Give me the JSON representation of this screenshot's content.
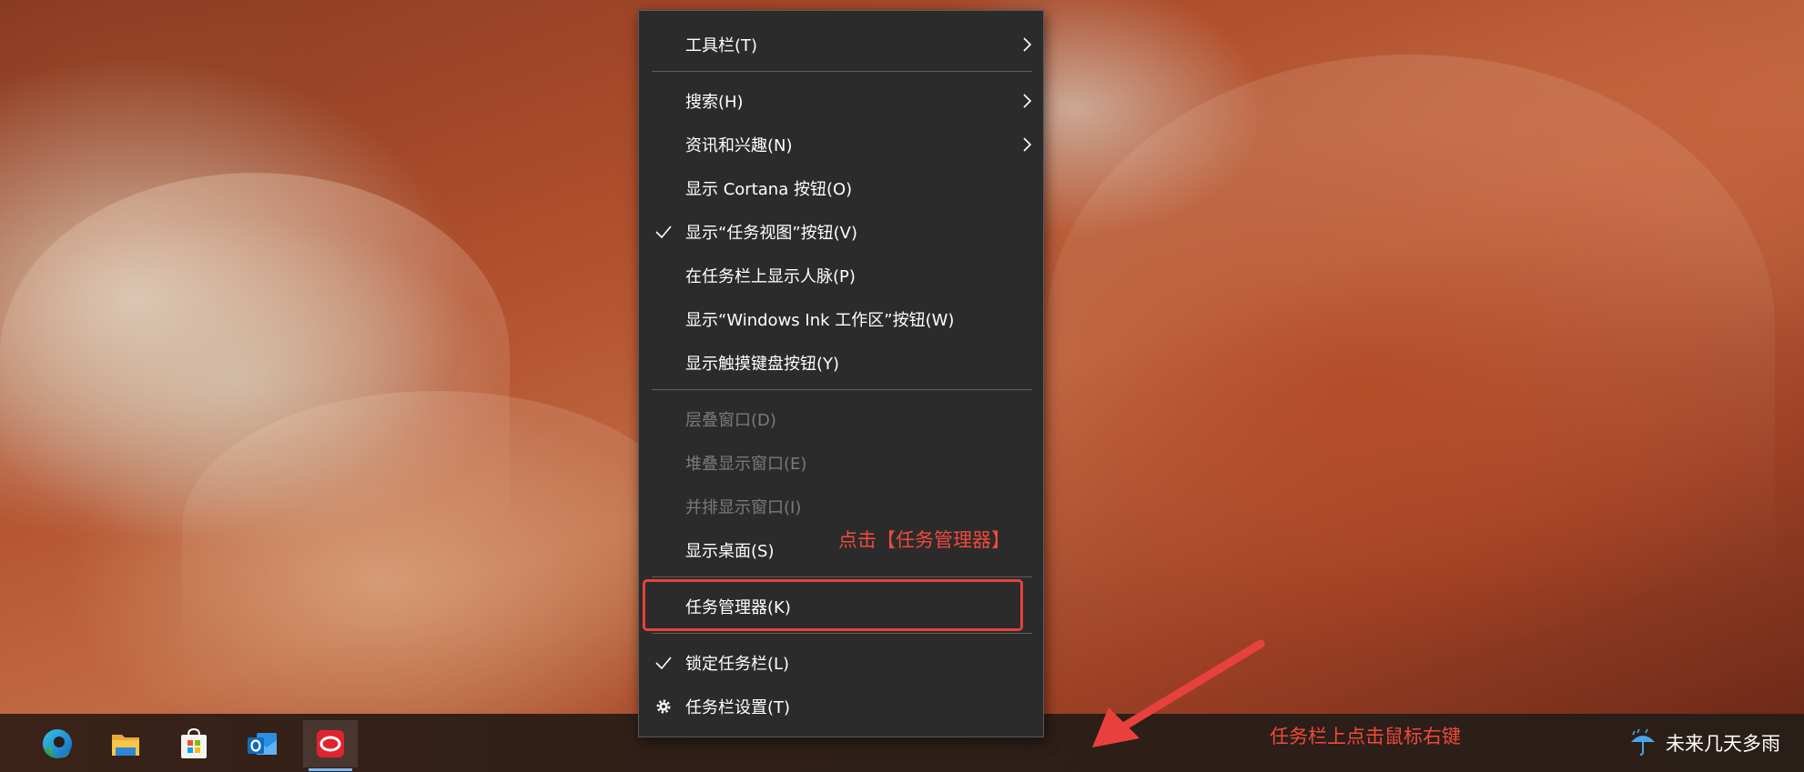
{
  "menu": {
    "items": [
      {
        "id": "toolbars",
        "label": "工具栏(T)",
        "submenu": true,
        "checked": false,
        "disabled": false
      },
      {
        "id": "search",
        "label": "搜索(H)",
        "submenu": true,
        "checked": false,
        "disabled": false
      },
      {
        "id": "news",
        "label": "资讯和兴趣(N)",
        "submenu": true,
        "checked": false,
        "disabled": false
      },
      {
        "id": "cortana",
        "label": "显示 Cortana 按钮(O)",
        "submenu": false,
        "checked": false,
        "disabled": false
      },
      {
        "id": "task-view",
        "label": "显示“任务视图”按钮(V)",
        "submenu": false,
        "checked": true,
        "disabled": false
      },
      {
        "id": "people",
        "label": "在任务栏上显示人脉(P)",
        "submenu": false,
        "checked": false,
        "disabled": false
      },
      {
        "id": "ink",
        "label": "显示“Windows Ink 工作区”按钮(W)",
        "submenu": false,
        "checked": false,
        "disabled": false
      },
      {
        "id": "touch-keyboard",
        "label": "显示触摸键盘按钮(Y)",
        "submenu": false,
        "checked": false,
        "disabled": false
      },
      {
        "id": "cascade",
        "label": "层叠窗口(D)",
        "submenu": false,
        "checked": false,
        "disabled": true
      },
      {
        "id": "stacked",
        "label": "堆叠显示窗口(E)",
        "submenu": false,
        "checked": false,
        "disabled": true
      },
      {
        "id": "side-by-side",
        "label": "并排显示窗口(I)",
        "submenu": false,
        "checked": false,
        "disabled": true
      },
      {
        "id": "show-desktop",
        "label": "显示桌面(S)",
        "submenu": false,
        "checked": false,
        "disabled": false
      },
      {
        "id": "task-manager",
        "label": "任务管理器(K)",
        "submenu": false,
        "checked": false,
        "disabled": false
      },
      {
        "id": "lock-taskbar",
        "label": "锁定任务栏(L)",
        "submenu": false,
        "checked": true,
        "disabled": false
      },
      {
        "id": "taskbar-settings",
        "label": "任务栏设置(T)",
        "submenu": false,
        "checked": false,
        "disabled": false,
        "icon": "gear-icon"
      }
    ]
  },
  "annotations": {
    "click_task_manager": "点击【任务管理器】",
    "right_click_taskbar": "任务栏上点击鼠标右键",
    "color": "#e8413d"
  },
  "taskbar": {
    "apps": [
      {
        "name": "edge-icon",
        "active": false
      },
      {
        "name": "file-explorer-icon",
        "active": false
      },
      {
        "name": "microsoft-store-icon",
        "active": false
      },
      {
        "name": "outlook-icon",
        "active": false
      },
      {
        "name": "red-app-icon",
        "active": true
      }
    ],
    "weather": {
      "icon": "umbrella-rain-icon",
      "text": "未来几天多雨"
    }
  },
  "colors": {
    "menu_bg": "#2b2b2b",
    "menu_text": "#ffffff",
    "menu_disabled": "#7a7a7a",
    "accent_underline": "#79b8f3"
  }
}
